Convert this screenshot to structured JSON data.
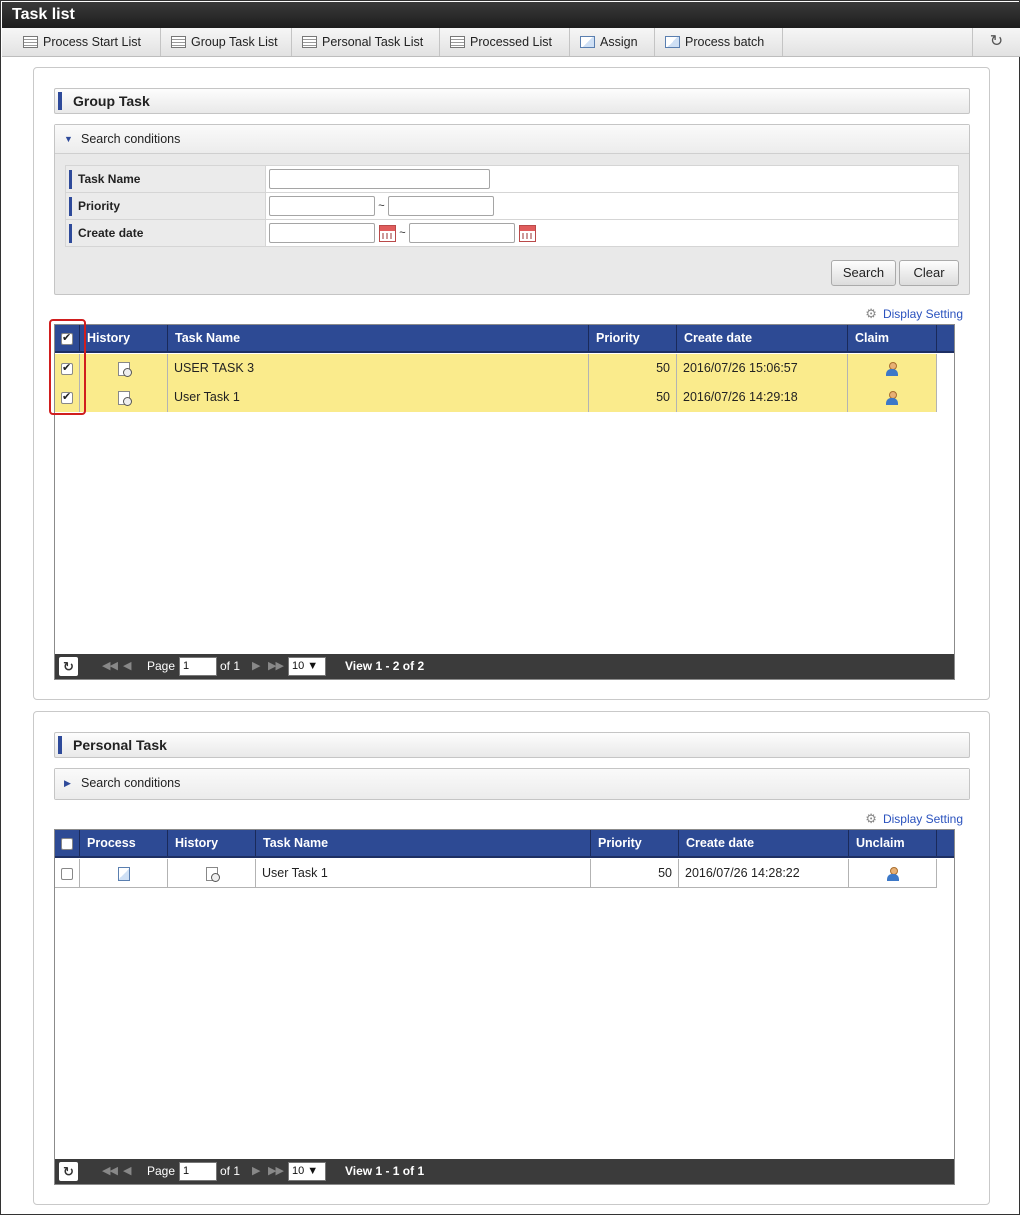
{
  "window": {
    "title": "Task list"
  },
  "toolbar": {
    "items": [
      {
        "label": "Process Start List",
        "icon": "list-icon"
      },
      {
        "label": "Group Task List",
        "icon": "list-icon"
      },
      {
        "label": "Personal Task List",
        "icon": "list-icon"
      },
      {
        "label": "Processed List",
        "icon": "list-icon"
      },
      {
        "label": "Assign",
        "icon": "assign-icon"
      },
      {
        "label": "Process batch",
        "icon": "batch-icon"
      }
    ],
    "refresh_icon": "↻"
  },
  "group_task": {
    "title": "Group Task",
    "search": {
      "header": "Search conditions",
      "fields": {
        "task_name": "Task Name",
        "priority": "Priority",
        "create_date": "Create date"
      },
      "tilde": "~",
      "search_label": "Search",
      "clear_label": "Clear"
    },
    "display_setting": "Display Setting",
    "columns": {
      "history": "History",
      "task_name": "Task Name",
      "priority": "Priority",
      "create_date": "Create date",
      "claim": "Claim"
    },
    "rows": [
      {
        "task_name": "USER TASK 3",
        "priority": "50",
        "create_date": "2016/07/26 15:06:57",
        "checked": true
      },
      {
        "task_name": "User Task 1",
        "priority": "50",
        "create_date": "2016/07/26 14:29:18",
        "checked": true
      }
    ],
    "pager": {
      "page_label": "Page",
      "page_value": "1",
      "of_label": "of 1",
      "rows_per_page": "10 ▼",
      "view_text": "View 1 - 2 of 2"
    }
  },
  "personal_task": {
    "title": "Personal Task",
    "search_header": "Search conditions",
    "display_setting": "Display Setting",
    "columns": {
      "process": "Process",
      "history": "History",
      "task_name": "Task Name",
      "priority": "Priority",
      "create_date": "Create date",
      "unclaim": "Unclaim"
    },
    "rows": [
      {
        "task_name": "User Task 1",
        "priority": "50",
        "create_date": "2016/07/26 14:28:22",
        "checked": false
      }
    ],
    "pager": {
      "page_label": "Page",
      "page_value": "1",
      "of_label": "of 1",
      "rows_per_page": "10 ▼",
      "view_text": "View 1 - 1 of 1"
    }
  },
  "colors": {
    "header_blue": "#2d4a94",
    "selected_row": "#faeb8c",
    "highlight_red": "#d01e1e",
    "link_blue": "#2a52be"
  }
}
